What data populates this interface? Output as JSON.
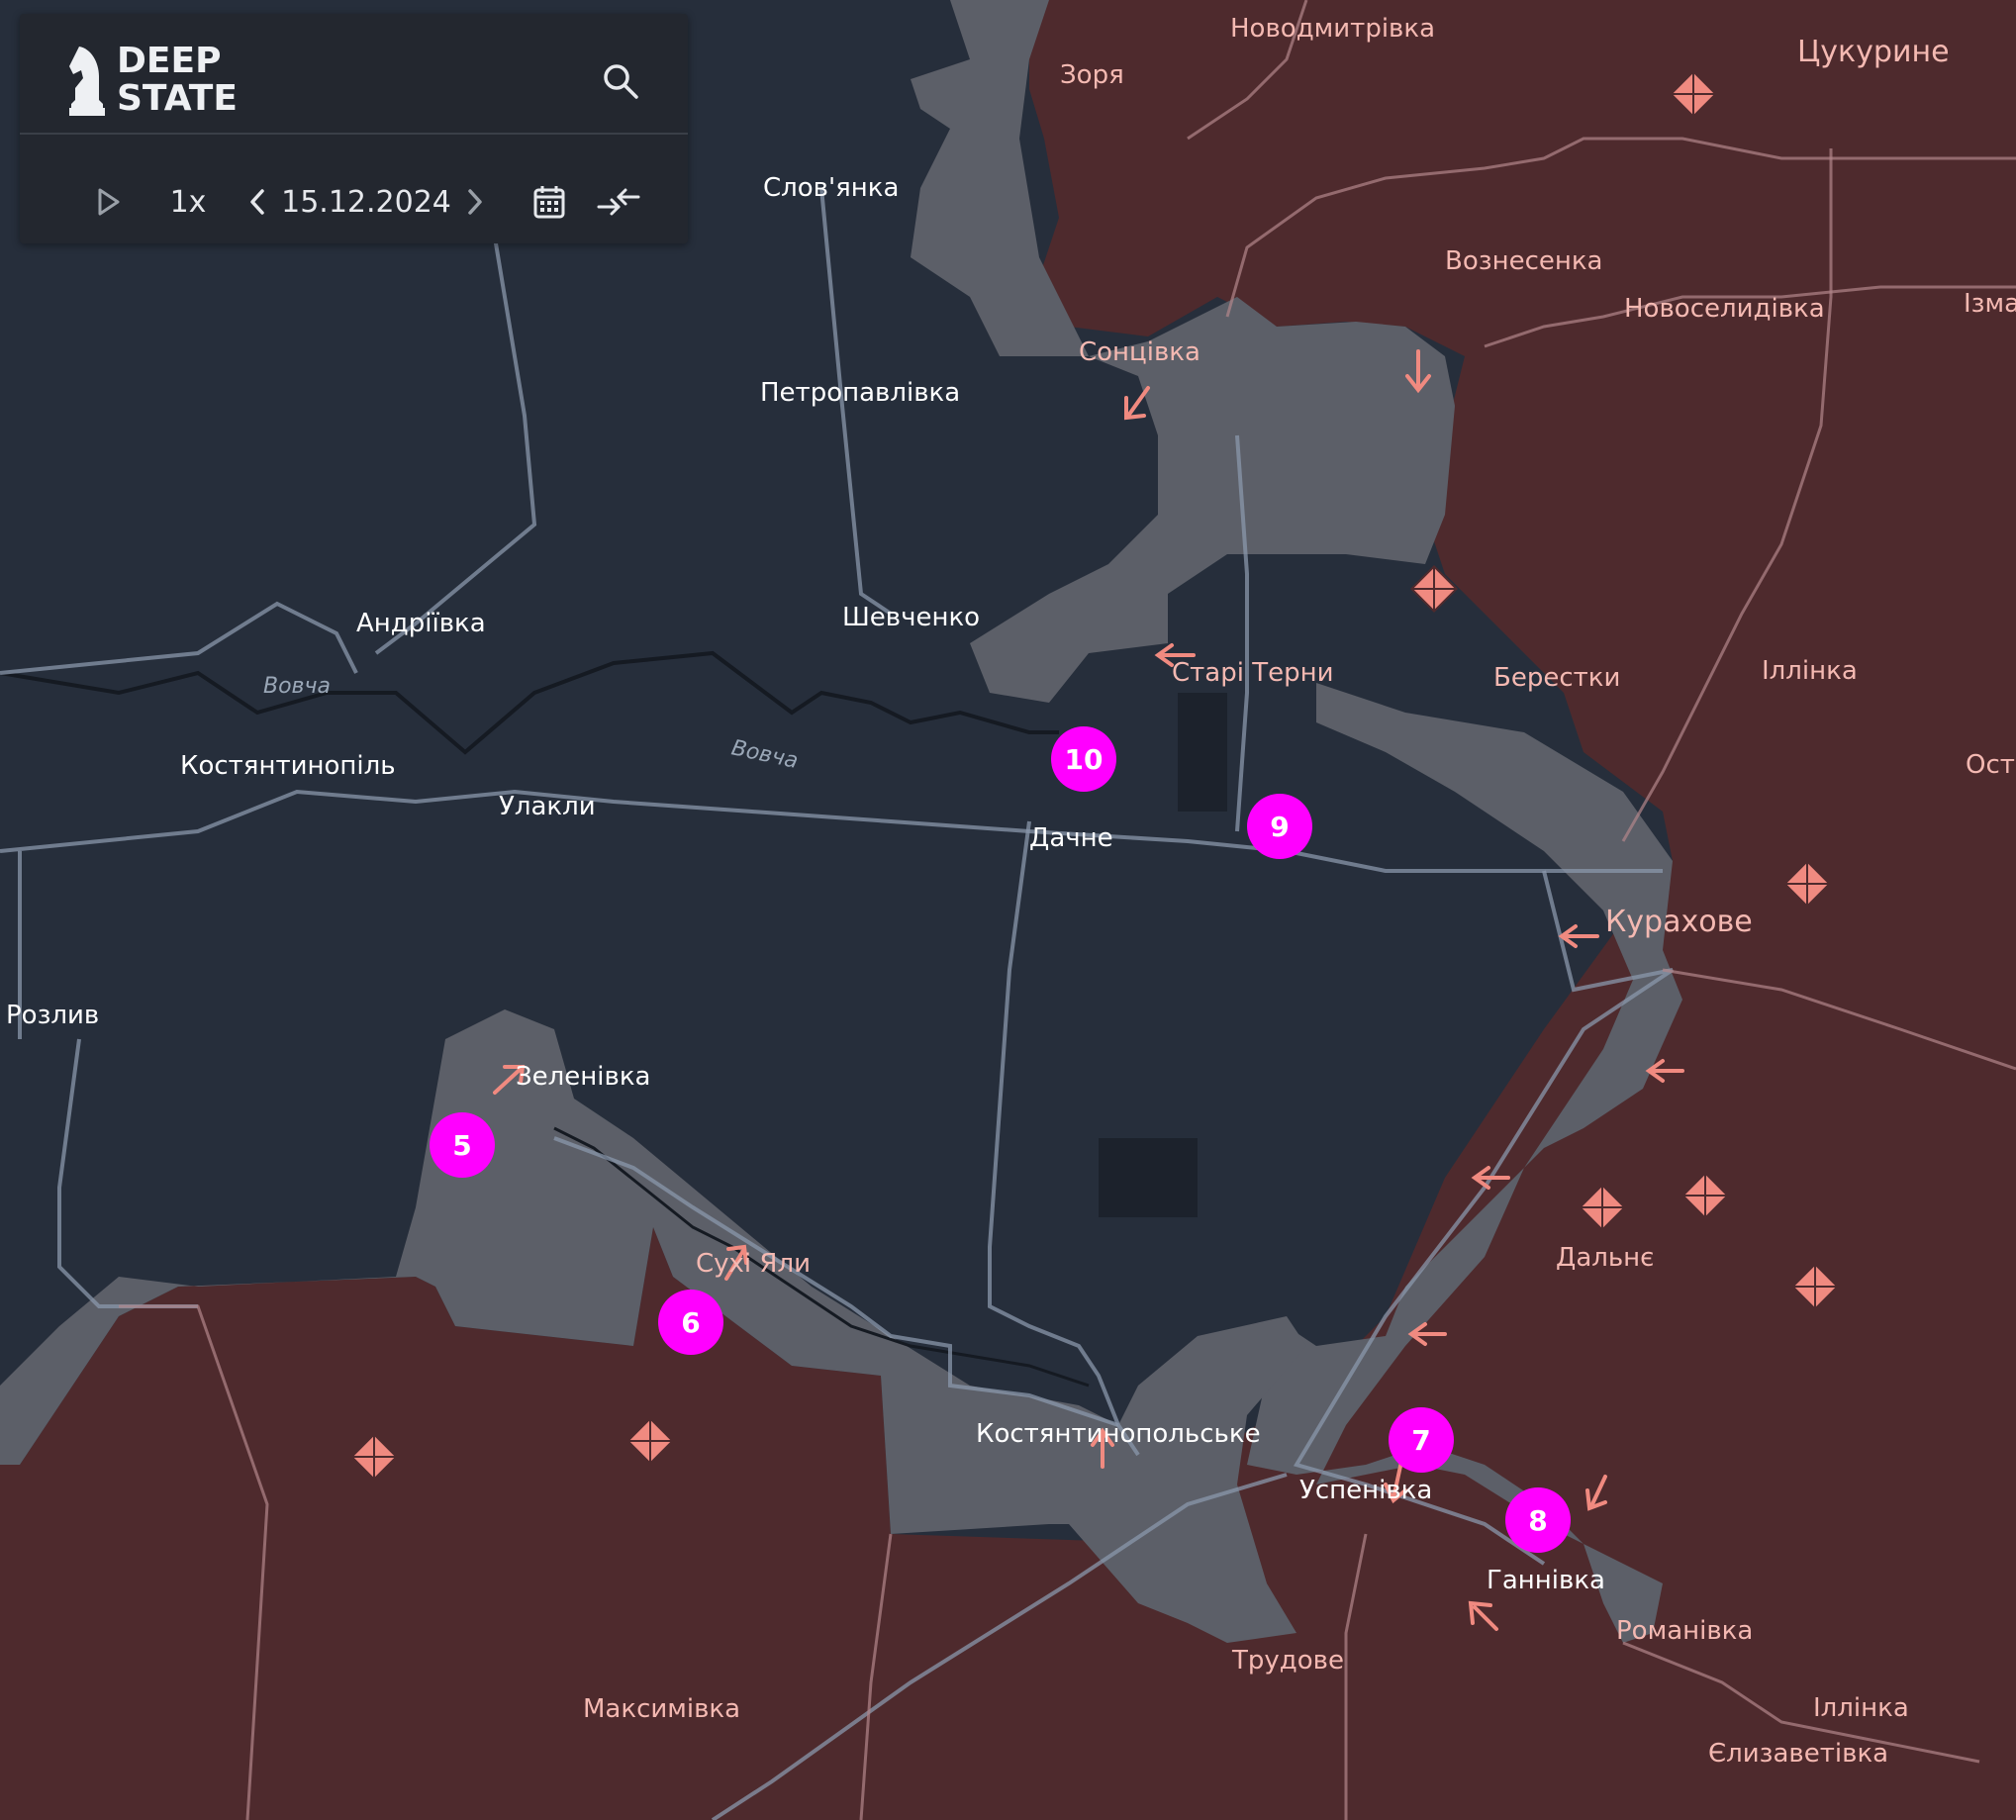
{
  "app": {
    "logo_line1": "DEEP",
    "logo_line2": "STATE"
  },
  "toolbar": {
    "play": "play-icon",
    "speed": "1x",
    "date": "15.12.2024",
    "prev": "chevron-left-icon",
    "next": "chevron-right-icon",
    "calendar": "calendar-icon",
    "compare": "compare-arrows-icon",
    "search": "search-icon"
  },
  "colors": {
    "controlled": "#262e3b",
    "occupied": "#4e2a2d",
    "contested": "#5c5f68",
    "marker": "#ff00ff",
    "arrow": "#f08a80"
  },
  "markers": [
    "5",
    "6",
    "7",
    "8",
    "9",
    "10"
  ],
  "places": {
    "novodmytrivka": "Новодмитрівка",
    "zoria": "Зоря",
    "tsukuryne": "Цукурине",
    "slovianka": "Слов'янка",
    "voznesenka": "Вознесенка",
    "novoselydivka": "Новоселидівка",
    "izma": "Ізма",
    "sontsivka": "Сонцівка",
    "petropavlivka": "Петропавлівка",
    "andriivka": "Андріївка",
    "shevchenko": "Шевченко",
    "stari_terny": "Старі Терни",
    "berestky": "Берестки",
    "illinka_east": "Іллінка",
    "ostr": "Остр",
    "kostiantynopil": "Костянтинопіль",
    "ulakly": "Улакли",
    "dachne": "Дачне",
    "kurakhove": "Курахове",
    "rozlyv": "Розлив",
    "zelenivka": "Зеленівка",
    "sukhi_yaly": "Сухі Яли",
    "dalne": "Дальнє",
    "kostiantynopolske": "Костянтинопольське",
    "uspenivka": "Успенівка",
    "hannivka": "Ганнівка",
    "romanivka": "Романівка",
    "trudove": "Трудове",
    "maksymivka": "Максимівка",
    "illinka_south": "Іллінка",
    "yelyzavetivka": "Єлизаветівка"
  },
  "rivers": {
    "vovcha_1": "Вовча",
    "vovcha_2": "Вовча"
  }
}
